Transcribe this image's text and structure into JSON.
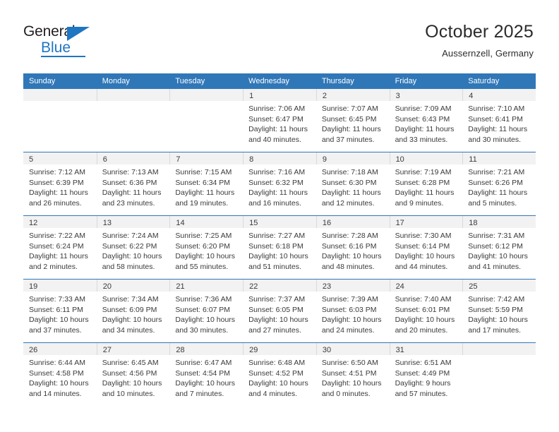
{
  "brand": {
    "name_top": "General",
    "name_bottom": "Blue",
    "accent_color": "#1f76c2"
  },
  "header": {
    "title": "October 2025",
    "subtitle": "Aussernzell, Germany"
  },
  "theme": {
    "header_blue": "#3077b8",
    "numband_gray": "#f2f2f2",
    "text": "#3a3a3a"
  },
  "calendar": {
    "weekdays": [
      "Sunday",
      "Monday",
      "Tuesday",
      "Wednesday",
      "Thursday",
      "Friday",
      "Saturday"
    ],
    "weeks": [
      [
        {
          "day": "",
          "sunrise": "",
          "sunset": "",
          "daylight": "",
          "empty": true
        },
        {
          "day": "",
          "sunrise": "",
          "sunset": "",
          "daylight": "",
          "empty": true
        },
        {
          "day": "",
          "sunrise": "",
          "sunset": "",
          "daylight": "",
          "empty": true
        },
        {
          "day": "1",
          "sunrise": "Sunrise: 7:06 AM",
          "sunset": "Sunset: 6:47 PM",
          "daylight": "Daylight: 11 hours and 40 minutes."
        },
        {
          "day": "2",
          "sunrise": "Sunrise: 7:07 AM",
          "sunset": "Sunset: 6:45 PM",
          "daylight": "Daylight: 11 hours and 37 minutes."
        },
        {
          "day": "3",
          "sunrise": "Sunrise: 7:09 AM",
          "sunset": "Sunset: 6:43 PM",
          "daylight": "Daylight: 11 hours and 33 minutes."
        },
        {
          "day": "4",
          "sunrise": "Sunrise: 7:10 AM",
          "sunset": "Sunset: 6:41 PM",
          "daylight": "Daylight: 11 hours and 30 minutes."
        }
      ],
      [
        {
          "day": "5",
          "sunrise": "Sunrise: 7:12 AM",
          "sunset": "Sunset: 6:39 PM",
          "daylight": "Daylight: 11 hours and 26 minutes."
        },
        {
          "day": "6",
          "sunrise": "Sunrise: 7:13 AM",
          "sunset": "Sunset: 6:36 PM",
          "daylight": "Daylight: 11 hours and 23 minutes."
        },
        {
          "day": "7",
          "sunrise": "Sunrise: 7:15 AM",
          "sunset": "Sunset: 6:34 PM",
          "daylight": "Daylight: 11 hours and 19 minutes."
        },
        {
          "day": "8",
          "sunrise": "Sunrise: 7:16 AM",
          "sunset": "Sunset: 6:32 PM",
          "daylight": "Daylight: 11 hours and 16 minutes."
        },
        {
          "day": "9",
          "sunrise": "Sunrise: 7:18 AM",
          "sunset": "Sunset: 6:30 PM",
          "daylight": "Daylight: 11 hours and 12 minutes."
        },
        {
          "day": "10",
          "sunrise": "Sunrise: 7:19 AM",
          "sunset": "Sunset: 6:28 PM",
          "daylight": "Daylight: 11 hours and 9 minutes."
        },
        {
          "day": "11",
          "sunrise": "Sunrise: 7:21 AM",
          "sunset": "Sunset: 6:26 PM",
          "daylight": "Daylight: 11 hours and 5 minutes."
        }
      ],
      [
        {
          "day": "12",
          "sunrise": "Sunrise: 7:22 AM",
          "sunset": "Sunset: 6:24 PM",
          "daylight": "Daylight: 11 hours and 2 minutes."
        },
        {
          "day": "13",
          "sunrise": "Sunrise: 7:24 AM",
          "sunset": "Sunset: 6:22 PM",
          "daylight": "Daylight: 10 hours and 58 minutes."
        },
        {
          "day": "14",
          "sunrise": "Sunrise: 7:25 AM",
          "sunset": "Sunset: 6:20 PM",
          "daylight": "Daylight: 10 hours and 55 minutes."
        },
        {
          "day": "15",
          "sunrise": "Sunrise: 7:27 AM",
          "sunset": "Sunset: 6:18 PM",
          "daylight": "Daylight: 10 hours and 51 minutes."
        },
        {
          "day": "16",
          "sunrise": "Sunrise: 7:28 AM",
          "sunset": "Sunset: 6:16 PM",
          "daylight": "Daylight: 10 hours and 48 minutes."
        },
        {
          "day": "17",
          "sunrise": "Sunrise: 7:30 AM",
          "sunset": "Sunset: 6:14 PM",
          "daylight": "Daylight: 10 hours and 44 minutes."
        },
        {
          "day": "18",
          "sunrise": "Sunrise: 7:31 AM",
          "sunset": "Sunset: 6:12 PM",
          "daylight": "Daylight: 10 hours and 41 minutes."
        }
      ],
      [
        {
          "day": "19",
          "sunrise": "Sunrise: 7:33 AM",
          "sunset": "Sunset: 6:11 PM",
          "daylight": "Daylight: 10 hours and 37 minutes."
        },
        {
          "day": "20",
          "sunrise": "Sunrise: 7:34 AM",
          "sunset": "Sunset: 6:09 PM",
          "daylight": "Daylight: 10 hours and 34 minutes."
        },
        {
          "day": "21",
          "sunrise": "Sunrise: 7:36 AM",
          "sunset": "Sunset: 6:07 PM",
          "daylight": "Daylight: 10 hours and 30 minutes."
        },
        {
          "day": "22",
          "sunrise": "Sunrise: 7:37 AM",
          "sunset": "Sunset: 6:05 PM",
          "daylight": "Daylight: 10 hours and 27 minutes."
        },
        {
          "day": "23",
          "sunrise": "Sunrise: 7:39 AM",
          "sunset": "Sunset: 6:03 PM",
          "daylight": "Daylight: 10 hours and 24 minutes."
        },
        {
          "day": "24",
          "sunrise": "Sunrise: 7:40 AM",
          "sunset": "Sunset: 6:01 PM",
          "daylight": "Daylight: 10 hours and 20 minutes."
        },
        {
          "day": "25",
          "sunrise": "Sunrise: 7:42 AM",
          "sunset": "Sunset: 5:59 PM",
          "daylight": "Daylight: 10 hours and 17 minutes."
        }
      ],
      [
        {
          "day": "26",
          "sunrise": "Sunrise: 6:44 AM",
          "sunset": "Sunset: 4:58 PM",
          "daylight": "Daylight: 10 hours and 14 minutes."
        },
        {
          "day": "27",
          "sunrise": "Sunrise: 6:45 AM",
          "sunset": "Sunset: 4:56 PM",
          "daylight": "Daylight: 10 hours and 10 minutes."
        },
        {
          "day": "28",
          "sunrise": "Sunrise: 6:47 AM",
          "sunset": "Sunset: 4:54 PM",
          "daylight": "Daylight: 10 hours and 7 minutes."
        },
        {
          "day": "29",
          "sunrise": "Sunrise: 6:48 AM",
          "sunset": "Sunset: 4:52 PM",
          "daylight": "Daylight: 10 hours and 4 minutes."
        },
        {
          "day": "30",
          "sunrise": "Sunrise: 6:50 AM",
          "sunset": "Sunset: 4:51 PM",
          "daylight": "Daylight: 10 hours and 0 minutes."
        },
        {
          "day": "31",
          "sunrise": "Sunrise: 6:51 AM",
          "sunset": "Sunset: 4:49 PM",
          "daylight": "Daylight: 9 hours and 57 minutes."
        },
        {
          "day": "",
          "sunrise": "",
          "sunset": "",
          "daylight": "",
          "empty": true
        }
      ]
    ]
  }
}
